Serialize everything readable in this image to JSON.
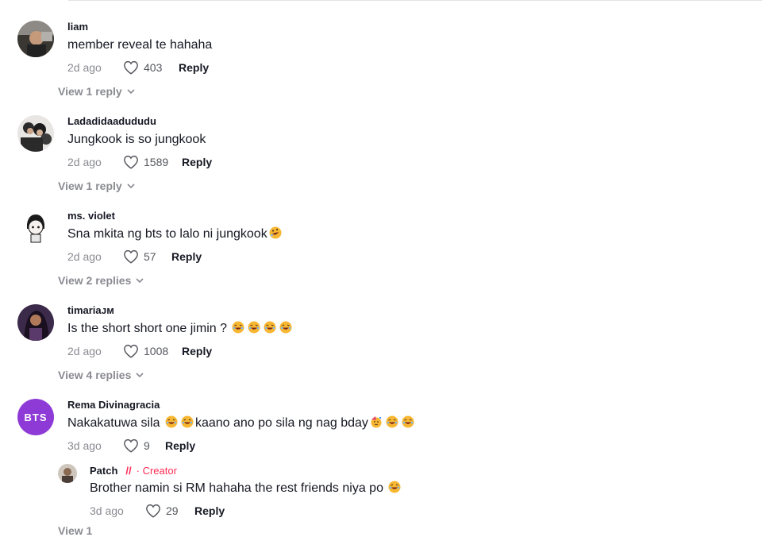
{
  "comments": [
    {
      "username": "liam",
      "text": "member reveal te hahaha",
      "date": "2d ago",
      "likes": "403",
      "reply_label": "Reply",
      "view_replies": "View 1 reply"
    },
    {
      "username": "Ladadidaadududu",
      "text": "Jungkook is so jungkook",
      "date": "2d ago",
      "likes": "1589",
      "reply_label": "Reply",
      "view_replies": "View 1 reply"
    },
    {
      "username": "ms. violet",
      "text": "Sna mkita ng bts to lalo ni jungkook",
      "date": "2d ago",
      "likes": "57",
      "reply_label": "Reply",
      "view_replies": "View 2 replies"
    },
    {
      "username": "timariaᴊᴍ",
      "text": "Is the short short one jimin ?",
      "date": "2d ago",
      "likes": "1008",
      "reply_label": "Reply",
      "view_replies": "View 4 replies"
    },
    {
      "username": "Rema Divinagracia",
      "avatar_text": "BTS",
      "text_a": "Nakakatuwa sila",
      "text_b": "kaano ano po sila ng nag bday",
      "date": "3d ago",
      "likes": "9",
      "reply_label": "Reply"
    }
  ],
  "reply": {
    "username": "Patch",
    "separator": "//",
    "creator_label": "· Creator",
    "text": "Brother namin si RM hahaha the rest friends niya po",
    "date": "3d ago",
    "likes": "29",
    "reply_label": "Reply"
  },
  "bottom_partial": "View 1",
  "colors": {
    "accent": "#fe2c55",
    "muted": "#8a8b91",
    "bts_avatar": "#8d3ad6"
  }
}
